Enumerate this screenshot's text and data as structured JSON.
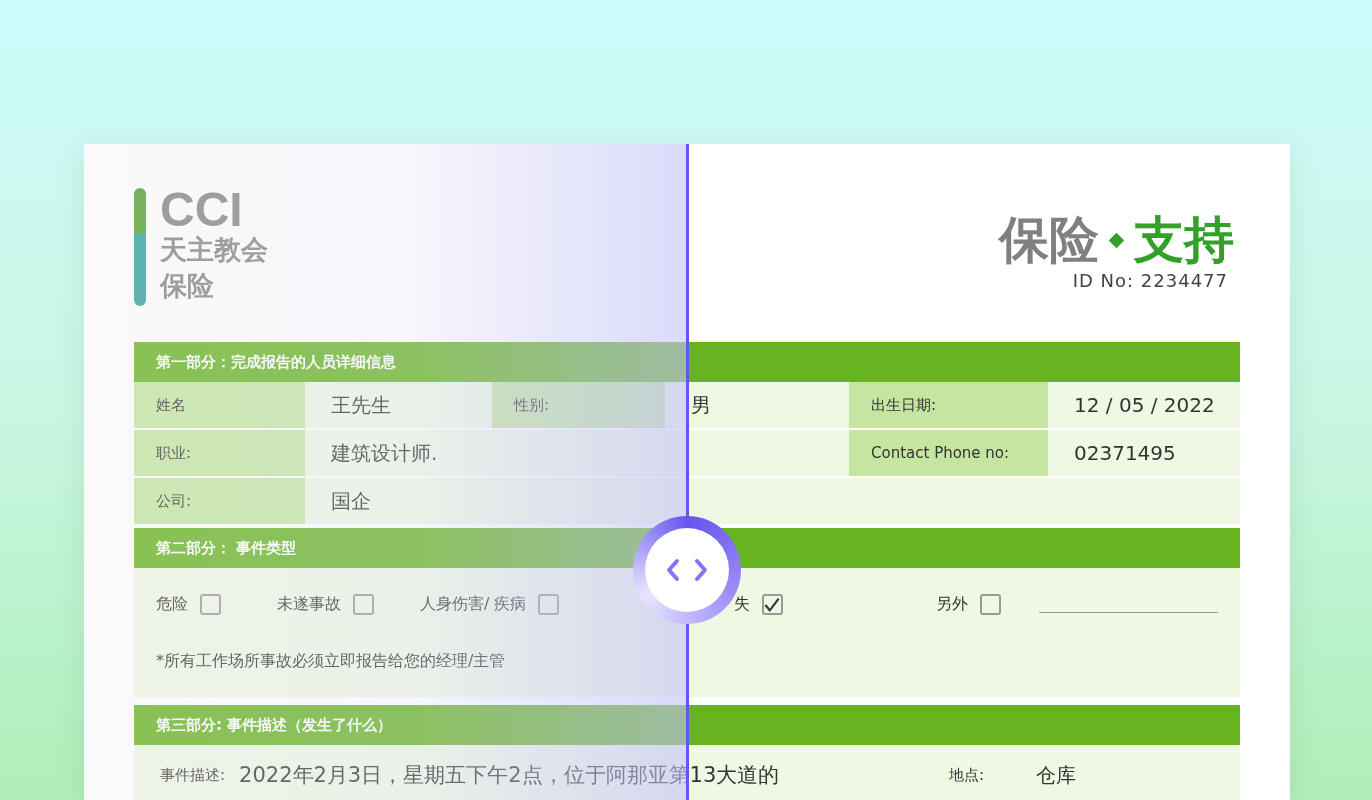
{
  "logo": {
    "mark": "CCI",
    "name_line1": "天主教会",
    "name_line2": "保险"
  },
  "title": {
    "part1": "保险",
    "part2": "支持"
  },
  "id_number": "ID No: 2234477",
  "section1": {
    "title": "第一部分：完成报告的人员详细信息",
    "rows": [
      {
        "cells": [
          {
            "kind": "label",
            "text": "姓名"
          },
          {
            "kind": "value",
            "text": "王先生"
          },
          {
            "kind": "label",
            "text": "性别:"
          },
          {
            "kind": "value",
            "text": "男"
          },
          {
            "kind": "label",
            "text": "出生日期:"
          },
          {
            "kind": "value",
            "text": "12 /  05  / 2022"
          }
        ]
      },
      {
        "cells": [
          {
            "kind": "label",
            "text": "职业:"
          },
          {
            "kind": "value",
            "text": "建筑设计师."
          },
          {
            "kind": "value",
            "text": ""
          },
          {
            "kind": "value",
            "text": ""
          },
          {
            "kind": "label",
            "text": "Contact Phone no:"
          },
          {
            "kind": "value",
            "text": "02371495"
          }
        ]
      },
      {
        "cells": [
          {
            "kind": "label",
            "text": "公司:"
          },
          {
            "kind": "value",
            "text": "国企"
          },
          {
            "kind": "value",
            "text": ""
          },
          {
            "kind": "value",
            "text": ""
          },
          {
            "kind": "value",
            "text": ""
          },
          {
            "kind": "value",
            "text": ""
          }
        ]
      }
    ]
  },
  "section2": {
    "title": "第二部分：  事件类型",
    "options": [
      {
        "label": "危险",
        "checked": false
      },
      {
        "label": "未遂事故",
        "checked": false
      },
      {
        "label": "人身伤害/ 疾病",
        "checked": false
      },
      {
        "label": "失",
        "checked": true
      },
      {
        "label": "另外",
        "checked": false
      }
    ],
    "note": "*所有工作场所事故必须立即报告给您的经理/主管"
  },
  "section3": {
    "title": "第三部分: 事件描述（发生了什么）",
    "description_label": "事件描述:",
    "description": "2022年2月3日，星期五下午2点，位于阿那亚第13大道的",
    "location_label": "地点:",
    "location": "仓库"
  },
  "comparison": {
    "level": 0.5
  }
}
